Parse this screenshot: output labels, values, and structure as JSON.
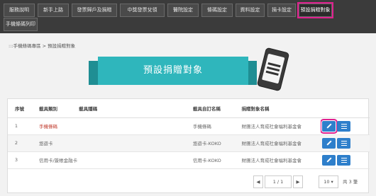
{
  "nav": {
    "row1": [
      {
        "label": "服務說明"
      },
      {
        "label": "新手上路"
      },
      {
        "label": "發票歸戶及捐贈"
      },
      {
        "label": "中獎發票兌領"
      },
      {
        "label": "醫院設定"
      },
      {
        "label": "條碼設定"
      },
      {
        "label": "資料設定"
      },
      {
        "label": "捐卡設定"
      },
      {
        "label": "預設捐贈對象"
      }
    ],
    "row2": [
      {
        "label": "手機條碼列印"
      }
    ]
  },
  "breadcrumb": ":::手機條碼專區 > 預設捐贈對象",
  "banner": {
    "title": "預設捐贈對象"
  },
  "table": {
    "headers": [
      "序號",
      "載具類別",
      "載具隱碼",
      "載具自訂名稱",
      "捐贈對象名稱",
      ""
    ],
    "rows": [
      {
        "no": "1",
        "type": "手機條碼",
        "hidden": "",
        "name": "手機條碼",
        "donee": "財團法人育成社會福利基金會"
      },
      {
        "no": "2",
        "type": "悠遊卡",
        "hidden": "",
        "name": "悠遊卡-KOKO",
        "donee": "財團法人育成社會福利基金會"
      },
      {
        "no": "3",
        "type": "信用卡/簽帳金融卡",
        "hidden": "",
        "name": "信用卡-KOKO",
        "donee": "財團法人育成社會福利基金會"
      }
    ]
  },
  "pager": {
    "prev": "◀",
    "page": "1 / 1",
    "next": "▶",
    "per_page": "10 ▾",
    "total": "共 3 筆"
  },
  "colors": {
    "accent": "#2fb6bc",
    "button": "#2e7fcb",
    "highlight": "#e0208f"
  },
  "icons": {
    "edit": "pencil-icon",
    "detail": "list-icon"
  }
}
